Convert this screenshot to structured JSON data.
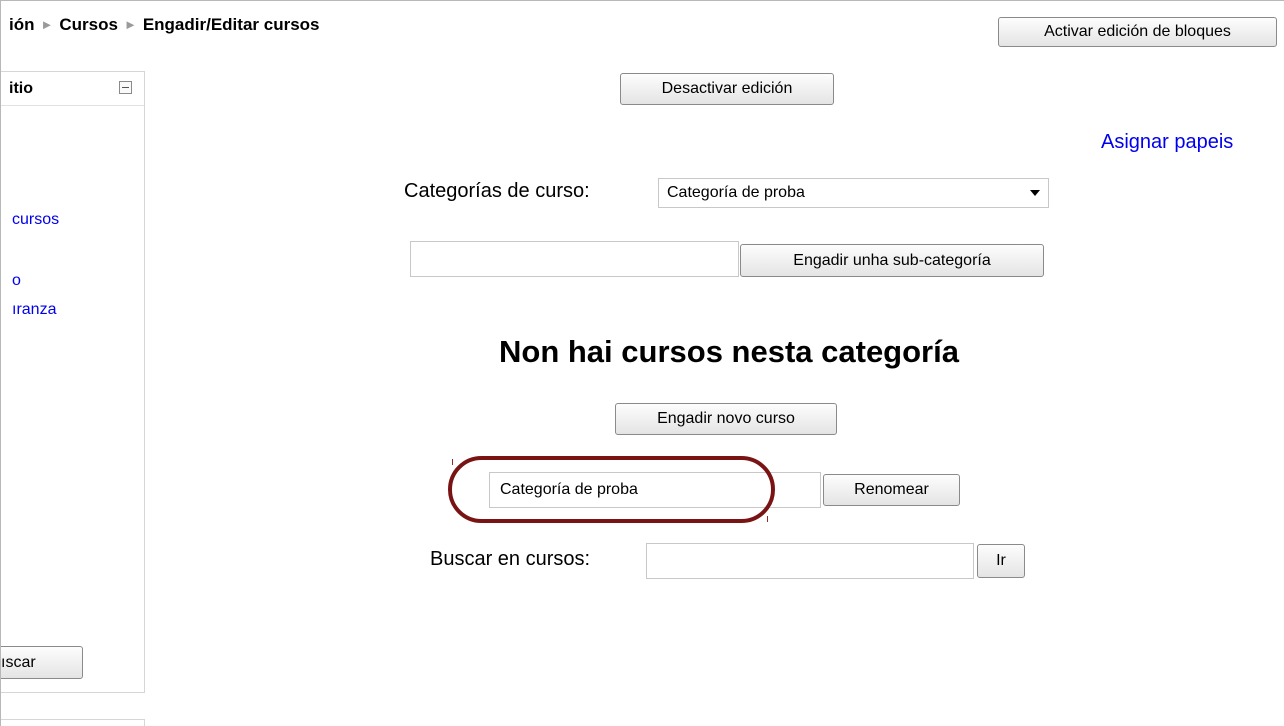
{
  "breadcrumb": {
    "items": [
      "ión",
      "Cursos",
      "Engadir/Editar cursos"
    ]
  },
  "header": {
    "activar_edicion_label": "Activar edición de bloques"
  },
  "sidebar": {
    "title": "itio",
    "links": [
      "cursos",
      "o",
      "ıranza"
    ],
    "search_button_label": "ıscar"
  },
  "main": {
    "desactivar_edicion_label": "Desactivar edición",
    "asignar_papeis_label": "Asignar papeis",
    "categorias_label": "Categorías de curso:",
    "categoria_selected": "Categoría de proba",
    "subcategory_input_value": "",
    "add_subcategory_label": "Engadir unha sub-categoría",
    "no_courses_heading": "Non hai cursos nesta categoría",
    "add_course_label": "Engadir novo curso",
    "rename_input_value": "Categoría de proba",
    "rename_label": "Renomear",
    "search_courses_label": "Buscar en cursos:",
    "search_input_value": "",
    "go_label": "Ir"
  },
  "colors": {
    "link": "#0000ee",
    "highlight": "#7a1414"
  }
}
